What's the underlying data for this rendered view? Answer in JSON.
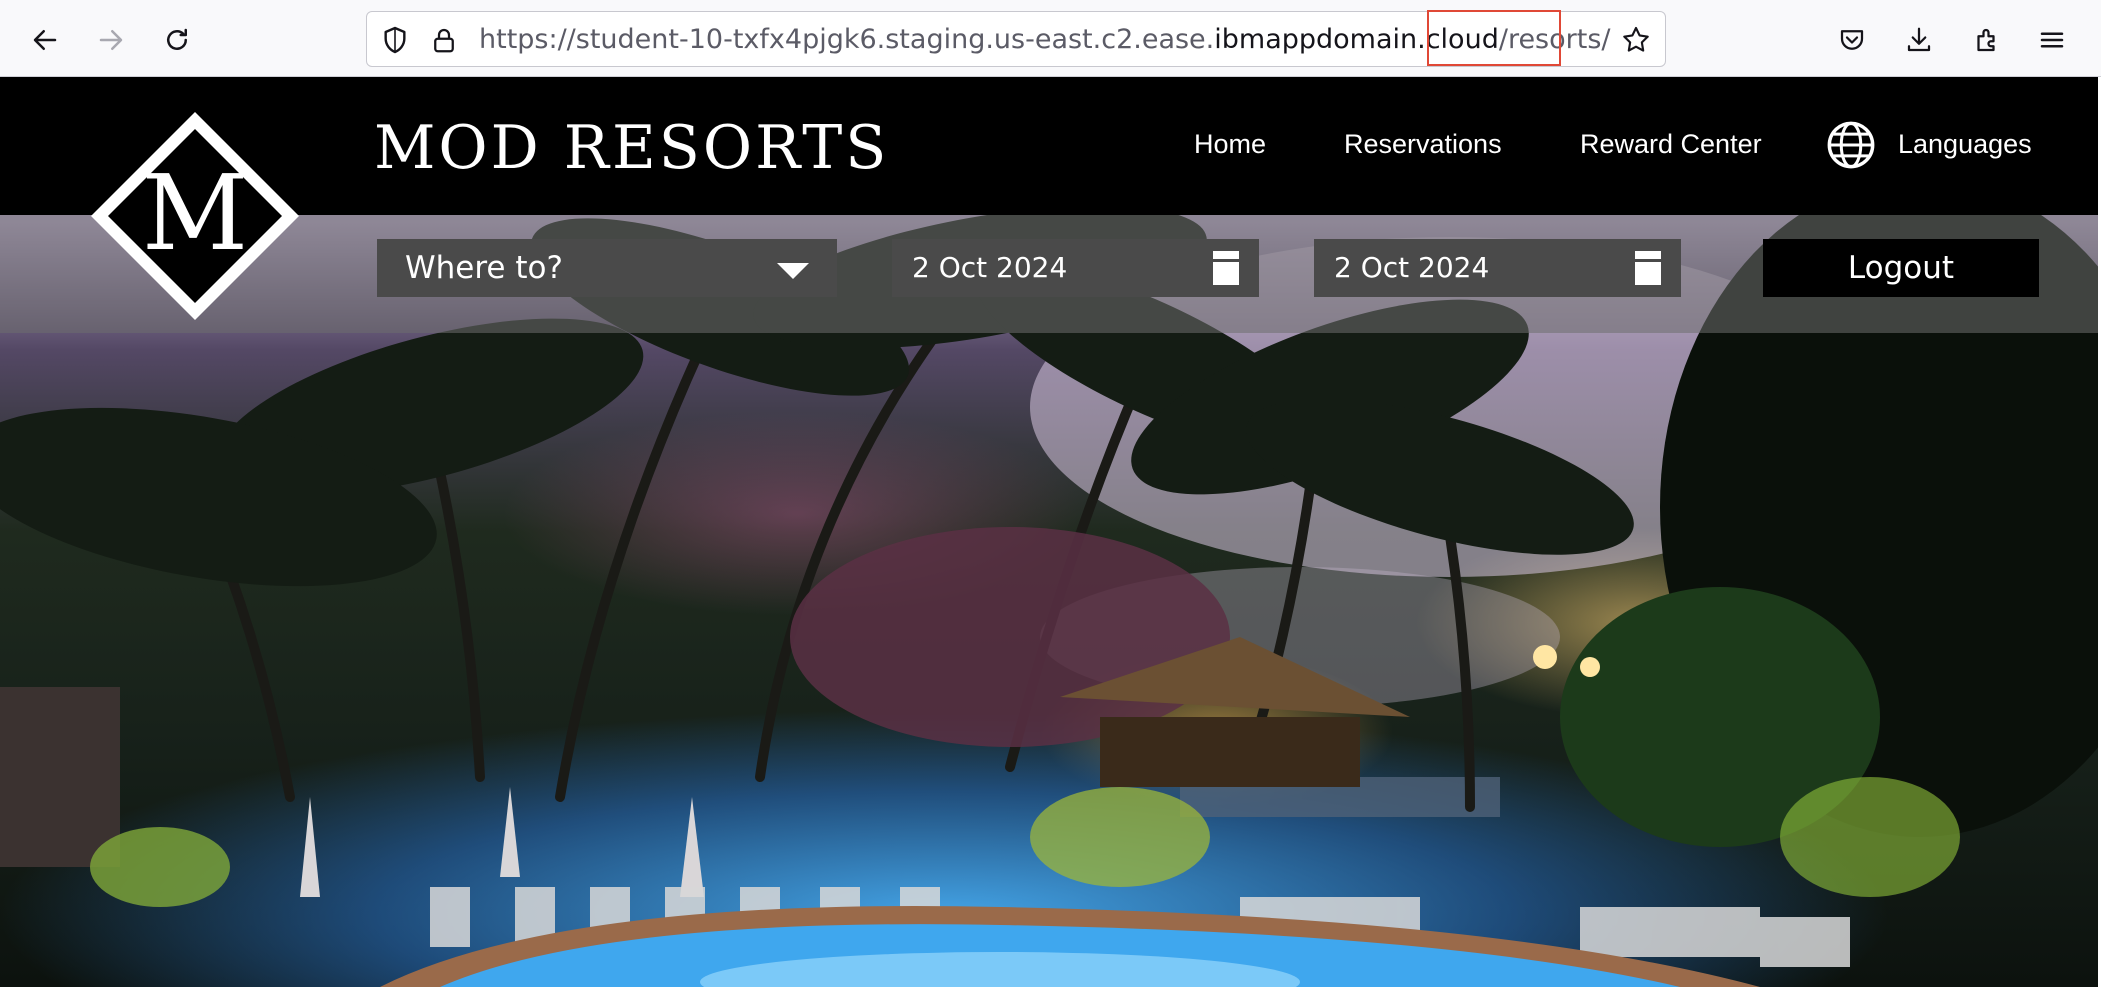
{
  "browser": {
    "url_scheme": "https://",
    "url_subdomain": "student-10-txfx4pjgk6.staging.us-east.c2.ease.",
    "url_host": "ibmappdomain.cloud",
    "url_path": "/resorts/",
    "icons": [
      "back-arrow-icon",
      "forward-arrow-icon",
      "reload-icon",
      "shield-icon",
      "lock-icon",
      "star-icon",
      "pocket-icon",
      "download-icon",
      "extensions-icon",
      "menu-icon"
    ]
  },
  "site": {
    "brand": "MOD RESORTS",
    "logo_letter": "M",
    "nav": {
      "home": "Home",
      "reservations": "Reservations",
      "reward_center": "Reward Center",
      "languages": "Languages"
    }
  },
  "search": {
    "destination_placeholder": "Where to?",
    "check_in": "2 Oct 2024",
    "check_out": "2 Oct 2024",
    "logout": "Logout"
  },
  "colors": {
    "header_bg": "#000000",
    "field_bg": "#4a4a4a",
    "url_highlight": "#e04836"
  }
}
